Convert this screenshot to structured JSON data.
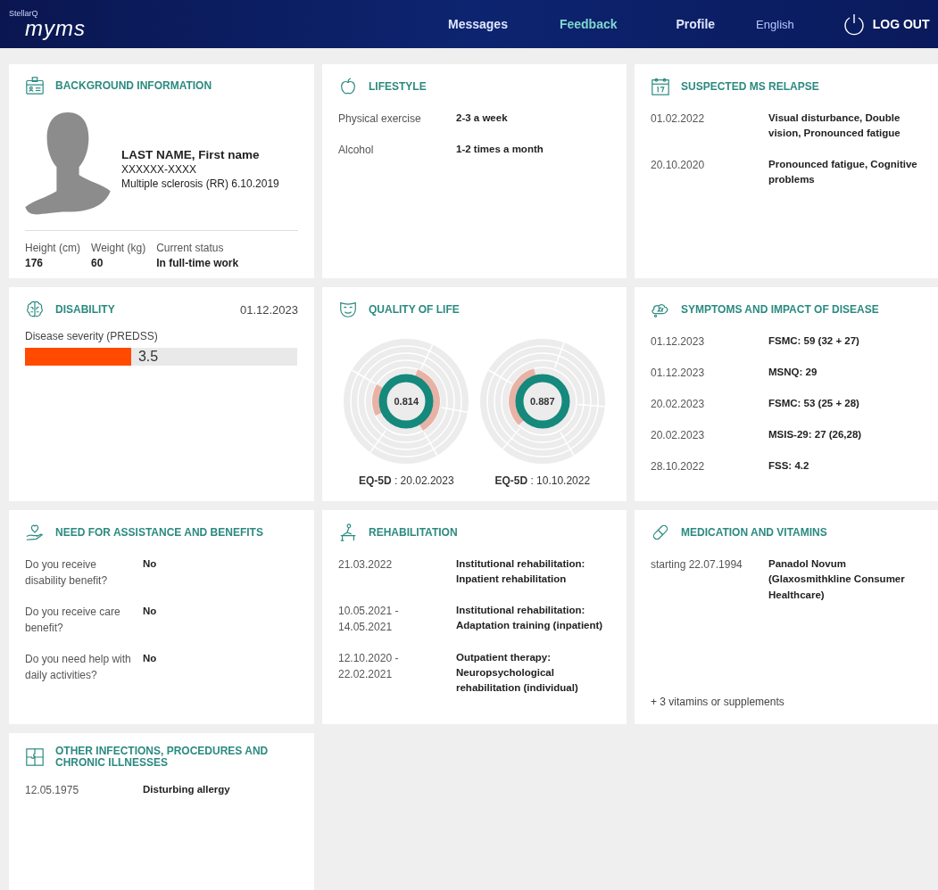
{
  "header": {
    "brand_small": "StellarQ",
    "brand": "myms",
    "nav": [
      {
        "label": "Messages"
      },
      {
        "label": "Feedback"
      },
      {
        "label": "Profile"
      }
    ],
    "language": "English",
    "logout": "LOG OUT"
  },
  "cards": [
    {
      "kind": "profile",
      "title": "BACKGROUND INFORMATION",
      "name": "LAST NAME, First name",
      "id_code": "XXXXXX-XXXX",
      "diagnosis": "Multiple sclerosis (RR) 6.10.2019",
      "stats": [
        {
          "label": "Height (cm)",
          "value": "176"
        },
        {
          "label": "Weight (kg)",
          "value": "60"
        },
        {
          "label": "Current status",
          "value": "In full-time work"
        }
      ]
    },
    {
      "kind": "pairs",
      "title": "LIFESTYLE",
      "rows": [
        {
          "label": "Physical exercise",
          "value": "2-3 a week"
        },
        {
          "label": "Alcohol",
          "value": "1-2 times a month"
        }
      ]
    },
    {
      "kind": "pairs",
      "title": "SUSPECTED MS RELAPSE",
      "rows": [
        {
          "label": "01.02.2022",
          "value": "Visual disturbance, Double vision, Pronounced fatigue"
        },
        {
          "label": "20.10.2020",
          "value": "Pronounced fatigue, Cognitive problems"
        }
      ]
    },
    {
      "kind": "bar",
      "title": "DISABILITY",
      "date": "01.12.2023",
      "label": "Disease severity (PREDSS)",
      "level": 0.39,
      "reading": "3.5"
    },
    {
      "kind": "rings",
      "title": "QUALITY OF LIFE",
      "charts": [
        {
          "score": "0.814",
          "caption": "**EQ-5D** : 20.02.2023"
        },
        {
          "score": "0.887",
          "caption": "**EQ-5D** : 10.10.2022"
        }
      ]
    },
    {
      "kind": "pairs",
      "title": "SYMPTOMS AND IMPACT OF DISEASE",
      "rows": [
        {
          "label": "01.12.2023",
          "value": "FSMC: 59 (32 + 27)"
        },
        {
          "label": "01.12.2023",
          "value": "MSNQ: 29"
        },
        {
          "label": "20.02.2023",
          "value": "FSMC: 53 (25 + 28)"
        },
        {
          "label": "20.02.2023",
          "value": "MSIS-29: 27 (26,28)"
        },
        {
          "label": "28.10.2022",
          "value": "FSS: 4.2"
        }
      ]
    },
    {
      "kind": "pairs",
      "title": "NEED FOR ASSISTANCE AND BENEFITS",
      "rows": [
        {
          "label": "Do you receive disability benefit?",
          "value": "No"
        },
        {
          "label": "Do you receive care benefit?",
          "value": "No"
        },
        {
          "label": "Do you need help with daily activities?",
          "value": "No"
        }
      ]
    },
    {
      "kind": "pairs",
      "title": "REHABILITATION",
      "rows": [
        {
          "label": "21.03.2022",
          "value": "Institutional rehabilitation: Inpatient rehabilitation"
        },
        {
          "label": "10.05.2021 - 14.05.2021",
          "value": "Institutional rehabilitation: Adaptation training (inpatient)"
        },
        {
          "label": "12.10.2020 - 22.02.2021",
          "value": "Outpatient therapy: Neuropsychological rehabilitation (individual)"
        }
      ]
    },
    {
      "kind": "pairs",
      "title": "MEDICATION AND VITAMINS",
      "rows": [
        {
          "label": "starting 22.07.1994",
          "value": "Panadol Novum (Glaxosmithkline Consumer Healthcare)"
        }
      ],
      "note": "+ 3 vitamins or supplements"
    },
    {
      "kind": "pairs",
      "title": "OTHER INFECTIONS, PROCEDURES AND CHRONIC ILLNESSES",
      "rows": [
        {
          "label": "12.05.1975",
          "value": "Disturbing allergy"
        }
      ]
    }
  ]
}
